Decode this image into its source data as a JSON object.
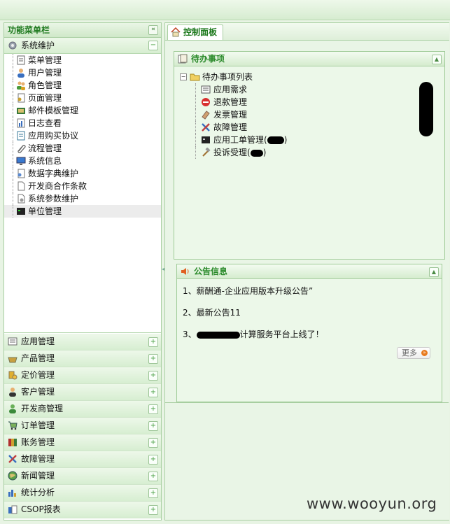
{
  "sidebar": {
    "title": "功能菜单栏",
    "collapse_symbol": "«",
    "active_group": {
      "label": "系统维护",
      "icon": "gear-icon",
      "toggle": "−"
    },
    "items": [
      {
        "label": "菜单管理",
        "icon": "menu-list-icon"
      },
      {
        "label": "用户管理",
        "icon": "user-icon"
      },
      {
        "label": "角色管理",
        "icon": "users-icon"
      },
      {
        "label": "页面管理",
        "icon": "page-key-icon"
      },
      {
        "label": "邮件模板管理",
        "icon": "mail-icon"
      },
      {
        "label": "日志查看",
        "icon": "chart-doc-icon"
      },
      {
        "label": "应用购买协议",
        "icon": "agreement-icon"
      },
      {
        "label": "流程管理",
        "icon": "paperclip-icon"
      },
      {
        "label": "系统信息",
        "icon": "monitor-icon"
      },
      {
        "label": "数据字典维护",
        "icon": "book-key-icon"
      },
      {
        "label": "开发商合作条款",
        "icon": "blank-page-icon"
      },
      {
        "label": "系统参数维护",
        "icon": "settings-page-icon"
      },
      {
        "label": "单位管理",
        "icon": "terminal-icon",
        "selected": true
      }
    ],
    "groups": [
      {
        "label": "应用管理",
        "icon": "app-icon",
        "toggle": "+"
      },
      {
        "label": "产品管理",
        "icon": "basket-icon",
        "toggle": "+"
      },
      {
        "label": "定价管理",
        "icon": "coins-icon",
        "toggle": "+"
      },
      {
        "label": "客户管理",
        "icon": "customer-icon",
        "toggle": "+"
      },
      {
        "label": "开发商管理",
        "icon": "developer-icon",
        "toggle": "+"
      },
      {
        "label": "订单管理",
        "icon": "cart-icon",
        "toggle": "+"
      },
      {
        "label": "账务管理",
        "icon": "ledger-icon",
        "toggle": "+"
      },
      {
        "label": "故障管理",
        "icon": "tools-icon",
        "toggle": "+"
      },
      {
        "label": "新闻管理",
        "icon": "globe-icon",
        "toggle": "+"
      },
      {
        "label": "统计分析",
        "icon": "bar-stats-icon",
        "toggle": "+"
      },
      {
        "label": "CSOP报表",
        "icon": "report-icon",
        "toggle": "+"
      }
    ]
  },
  "tab": {
    "label": "控制面板",
    "icon": "home-icon"
  },
  "todo": {
    "title": "待办事项",
    "tree_root": "待办事项列表",
    "tree_toggle": "−",
    "items": [
      {
        "label": "应用需求",
        "icon": "form-icon"
      },
      {
        "label": "退款管理",
        "icon": "stop-icon"
      },
      {
        "label": "发票管理",
        "icon": "eraser-icon"
      },
      {
        "label": "故障管理",
        "icon": "tools-icon"
      },
      {
        "label": "应用工单管理",
        "icon": "terminal-icon",
        "suffix": ")"
      },
      {
        "label": "投诉受理",
        "icon": "hammer-icon",
        "suffix": ")"
      }
    ]
  },
  "news": {
    "title": "公告信息",
    "items": [
      "1、薪酬通-企业应用版本升级公告”",
      "2、最新公告11",
      "3、",
      "计算服务平台上线了！"
    ],
    "more_label": "更多",
    "more_arrow": "»"
  },
  "watermark": "www.wooyun.org"
}
